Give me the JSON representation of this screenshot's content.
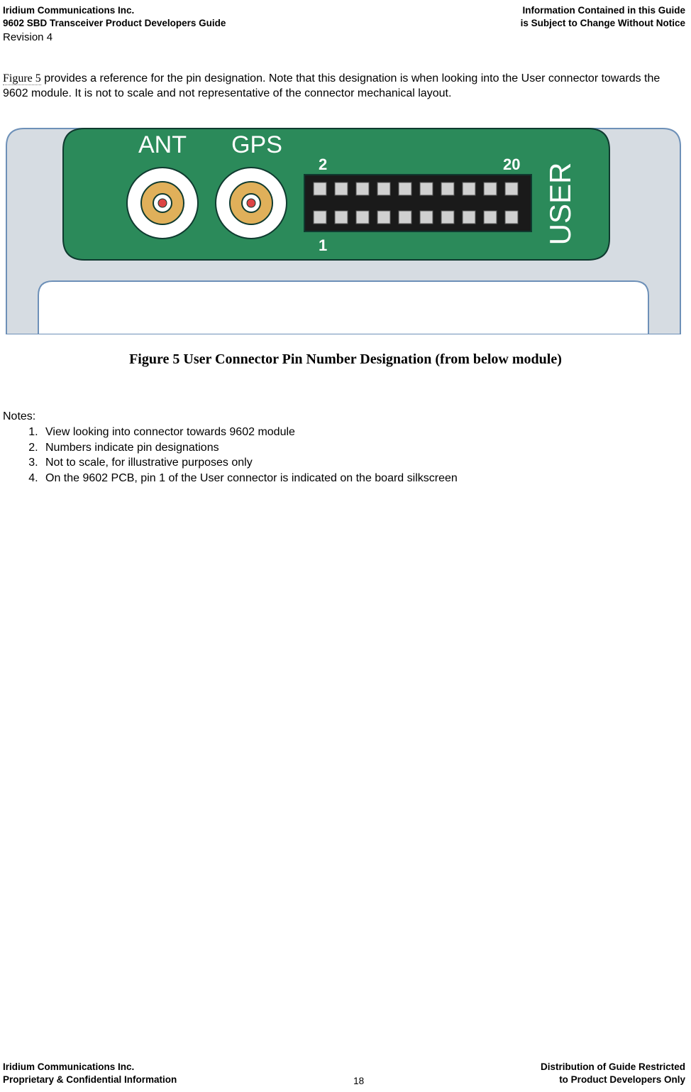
{
  "header": {
    "left_line1": "Iridium Communications Inc.",
    "left_line2": "9602 SBD Transceiver Product Developers Guide",
    "right_line1": "Information Contained in this Guide",
    "right_line2": "is Subject to Change Without Notice",
    "revision": "Revision 4"
  },
  "body": {
    "figure_link": "Figure 5",
    "para_rest": " provides a reference for the pin designation. Note that this designation is when looking into the User connector towards the 9602 module. It is not to scale and not representative of the connector mechanical layout."
  },
  "figure": {
    "labels": {
      "ant": "ANT",
      "gps": "GPS",
      "user": "USER",
      "pin_top_left": "2",
      "pin_top_right": "20",
      "pin_bottom_left": "1"
    },
    "caption": "Figure 5 User Connector Pin Number Designation (from below module)"
  },
  "notes": {
    "heading": "Notes:",
    "items": [
      "View looking into connector towards 9602 module",
      "Numbers indicate pin designations",
      "Not to scale, for illustrative purposes only",
      "On the 9602 PCB, pin 1 of the User connector is indicated on the board silkscreen"
    ]
  },
  "footer": {
    "left_line1": "Iridium Communications Inc.",
    "left_line2": "Proprietary & Confidential Information",
    "right_line1": "Distribution of Guide Restricted",
    "right_line2": "to Product Developers Only",
    "page": "18"
  },
  "colors": {
    "pcb_green": "#2b8a5a",
    "module_grey": "#d6dce2",
    "connector_black": "#1a1a1a",
    "pin_grey": "#d0d0d0",
    "gold": "#e0b05a"
  }
}
